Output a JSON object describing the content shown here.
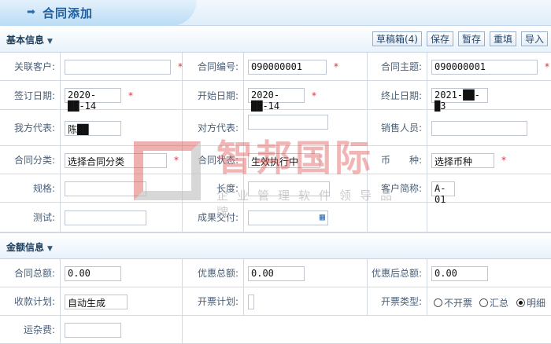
{
  "header": {
    "title": "合同添加",
    "icon": "arrow-right-icon"
  },
  "basic": {
    "title": "基本信息",
    "buttons": [
      "草稿箱(4)",
      "保存",
      "暂存",
      "重填",
      "导入"
    ],
    "customer_label": "关联客户:",
    "customer_value": "",
    "contract_no_label": "合同编号:",
    "contract_no_value": "090000001",
    "subject_label": "合同主题:",
    "subject_value": "090000001",
    "sign_date_label": "签订日期:",
    "sign_date_value": "2020-██-14",
    "start_date_label": "开始日期:",
    "start_date_value": "2020-██-14",
    "end_date_label": "终止日期:",
    "end_date_value": "2021-██-█3",
    "our_rep_label": "我方代表:",
    "our_rep_value": "陈██",
    "their_rep_label": "对方代表:",
    "their_rep_value": "",
    "sales_label": "销售人员:",
    "sales_value": "",
    "category_label": "合同分类:",
    "category_value": "选择合同分类",
    "status_label": "合同状态:",
    "status_value": "生效执行中",
    "currency_label": "币　　种:",
    "currency_value": "选择币种",
    "spec_label": "规格:",
    "spec_value": "",
    "length_label": "长度:",
    "length_value": "",
    "short_name_label": "客户简称:",
    "short_name_value": "A-01",
    "test_label": "测试:",
    "test_value": "",
    "delivery_label": "成果交付:",
    "delivery_value": "",
    "required_mark": "*"
  },
  "amount": {
    "title": "金额信息",
    "total_label": "合同总额:",
    "total_value": "0.00",
    "discount_label": "优惠总额:",
    "discount_value": "0.00",
    "after_label": "优惠后总额:",
    "after_value": "0.00",
    "payment_plan_label": "收款计划:",
    "payment_plan_value": "自动生成",
    "invoice_plan_label": "开票计划:",
    "invoice_plan_value": "",
    "invoice_type_label": "开票类型:",
    "invoice_options": [
      "不开票",
      "汇总",
      "明细"
    ],
    "invoice_selected": "明细",
    "freight_label": "运杂费:",
    "freight_value": ""
  },
  "watermark": {
    "text": "智邦国际",
    "tagline": "企业管理软件领导品牌"
  },
  "colors": {
    "required": "#e0303a",
    "title": "#1f5e9e"
  }
}
